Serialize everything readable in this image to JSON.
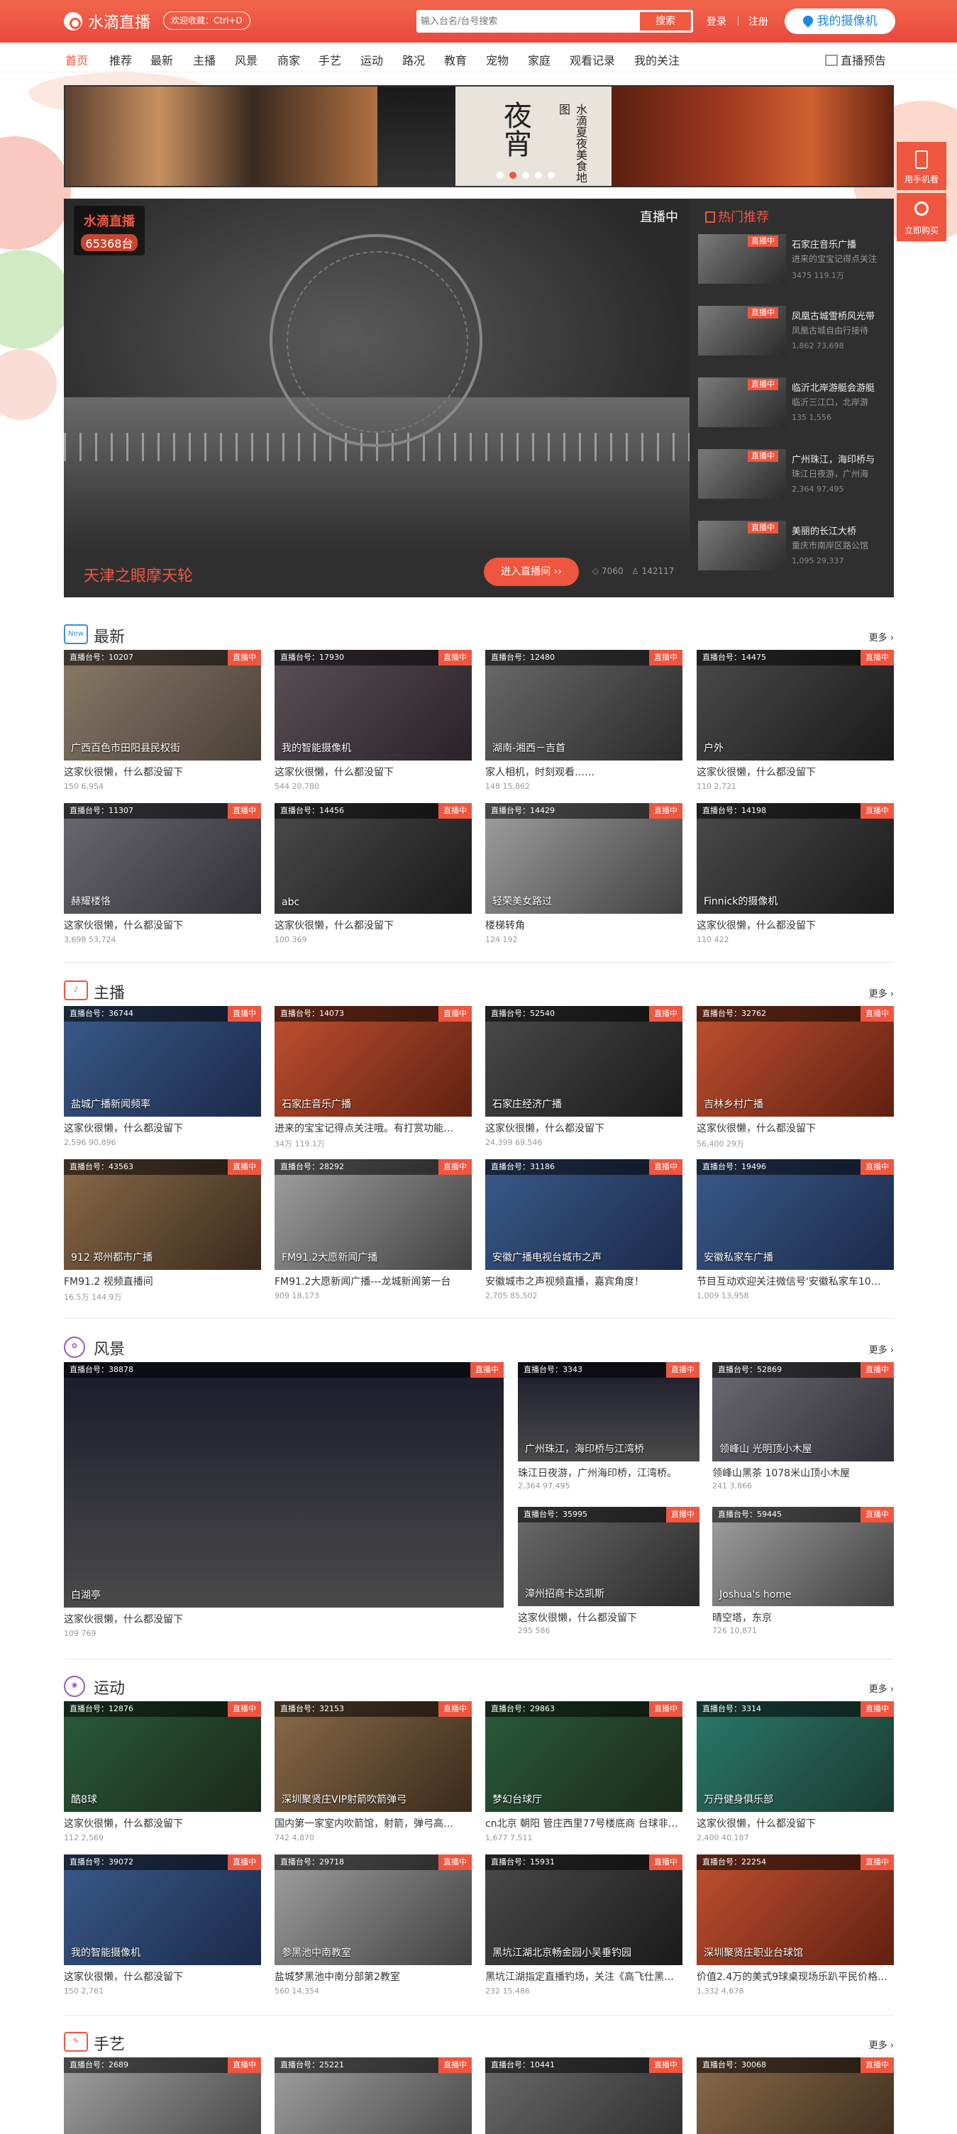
{
  "header": {
    "logo_text": "水滴直播",
    "favorite_label": "欢迎收藏：Ctrl+D",
    "search_placeholder": "输入台名/台号搜索",
    "search_button": "搜索",
    "login": "登录",
    "register": "注册",
    "my_camera": "我的摄像机"
  },
  "nav": {
    "items": [
      "首页",
      "推荐",
      "最新",
      "主播",
      "风景",
      "商家",
      "手艺",
      "运动",
      "路况",
      "教育",
      "宠物",
      "家庭",
      "观看记录",
      "我的关注"
    ],
    "active_index": 0,
    "preview": "直播预告"
  },
  "banner": {
    "title": "夜宵",
    "subtitle": "水滴夏夜美食地图",
    "slides": 5,
    "active_slide": 1
  },
  "side_buttons": [
    "用手机看",
    "立即购买"
  ],
  "featured": {
    "brand": "水滴直播",
    "count": "65368台",
    "live_label": "直播中",
    "name": "天津之眼摩天轮",
    "enter_label": "进入直播间 ››",
    "stat1": "7060",
    "stat2": "142117"
  },
  "hot": {
    "title": "热门推荐",
    "items": [
      {
        "badge": "直播中",
        "title": "石家庄音乐广播",
        "desc": "进来的宝宝记得点关注",
        "stats": "3475  119.1万"
      },
      {
        "badge": "直播中",
        "title": "凤凰古城雪桥风光带",
        "desc": "凤凰古城自由行接待",
        "stats": "1,862  73,698"
      },
      {
        "badge": "直播中",
        "title": "临沂北岸游艇会游艇",
        "desc": "临沂三江口，北岸游",
        "stats": "135  1,556"
      },
      {
        "badge": "直播中",
        "title": "广州珠江，海印桥与",
        "desc": "珠江日夜游，广州海",
        "stats": "2,364  97,495"
      },
      {
        "badge": "直播中",
        "title": "美丽的长江大桥",
        "desc": "重庆市南岸区路公馆",
        "stats": "1,095  29,337"
      }
    ]
  },
  "sections": {
    "latest": {
      "title": "最新",
      "icon": "New",
      "more": "更多 ›",
      "cards": [
        {
          "id": "直播台号：10207",
          "live": "直播中",
          "name": "广西百色市田阳县民权街",
          "desc": "这家伙很懒，什么都没留下",
          "stats": "150  6,954"
        },
        {
          "id": "直播台号：17930",
          "live": "直播中",
          "name": "我的智能摄像机",
          "desc": "这家伙很懒，什么都没留下",
          "stats": "544  20,780"
        },
        {
          "id": "直播台号：12480",
          "live": "直播中",
          "name": "湖南-湘西－吉首",
          "desc": "家人相机，时刻观看……",
          "stats": "148  15,862"
        },
        {
          "id": "直播台号：14475",
          "live": "直播中",
          "name": "户外",
          "desc": "这家伙很懒，什么都没留下",
          "stats": "110  2,721"
        },
        {
          "id": "直播台号：11307",
          "live": "直播中",
          "name": "赫耀楼恪",
          "desc": "这家伙很懒，什么都没留下",
          "stats": "3,698  53,724"
        },
        {
          "id": "直播台号：14456",
          "live": "直播中",
          "name": "abc",
          "desc": "这家伙很懒，什么都没留下",
          "stats": "100  369"
        },
        {
          "id": "直播台号：14429",
          "live": "直播中",
          "name": "轻荣美女路过",
          "desc": "楼梯转角",
          "stats": "124  192"
        },
        {
          "id": "直播台号：14198",
          "live": "直播中",
          "name": "Finnick的摄像机",
          "desc": "这家伙很懒，什么都没留下",
          "stats": "110  422"
        }
      ]
    },
    "anchor": {
      "title": "主播",
      "more": "更多 ›",
      "cards": [
        {
          "id": "直播台号：36744",
          "live": "直播中",
          "name": "盐城广播新闻频率",
          "desc": "这家伙很懒，什么都没留下",
          "stats": "2,596  90,896"
        },
        {
          "id": "直播台号：14073",
          "live": "直播中",
          "name": "石家庄音乐广播",
          "desc": "进来的宝宝记得点关注哦。有打赏功能…",
          "stats": "34万  119.1万"
        },
        {
          "id": "直播台号：52540",
          "live": "直播中",
          "name": "石家庄经济广播",
          "desc": "这家伙很懒，什么都没留下",
          "stats": "24,399  69,546"
        },
        {
          "id": "直播台号：32762",
          "live": "直播中",
          "name": "吉林乡村广播",
          "desc": "这家伙很懒，什么都没留下",
          "stats": "56,400  29万"
        },
        {
          "id": "直播台号：43563",
          "live": "直播中",
          "name": "912 郑州都市广播",
          "desc": "FM91.2 视频直播间",
          "stats": "16.5万  144.9万"
        },
        {
          "id": "直播台号：28292",
          "live": "直播中",
          "name": "FM91.2大愿新闻广播",
          "desc": "FM91.2大愿新闻广播---龙城新闻第一台",
          "stats": "909  18,173"
        },
        {
          "id": "直播台号：31186",
          "live": "直播中",
          "name": "安徽广播电视台城市之声",
          "desc": "安徽城市之声视频直播，嘉宾角度！",
          "stats": "2,705  85,502"
        },
        {
          "id": "直播台号：19496",
          "live": "直播中",
          "name": "安徽私家车广播",
          "desc": "节目互动欢迎关注微信号'安徽私家车10…",
          "stats": "1,009  13,958"
        }
      ]
    },
    "scenery": {
      "title": "风景",
      "more": "更多 ›",
      "big": {
        "id": "直播台号：38878",
        "live": "直播中",
        "name": "白湖亭",
        "desc": "这家伙很懒，什么都没留下",
        "stats": "109  769"
      },
      "cards": [
        {
          "id": "直播台号：3343",
          "live": "直播中",
          "name": "广州珠江，海印桥与江湾桥",
          "desc": "珠江日夜游，广州海印桥，江湾桥。",
          "stats": "2,364  97,495"
        },
        {
          "id": "直播台号：52869",
          "live": "直播中",
          "name": "领峰山 光明顶小木屋",
          "desc": "领峰山黑茶 1078米山顶小木屋",
          "stats": "241  3,866"
        },
        {
          "id": "直播台号：35995",
          "live": "直播中",
          "name": "漳州招商卡达凯斯",
          "desc": "这家伙很懒，什么都没留下",
          "stats": "295  586"
        },
        {
          "id": "直播台号：59445",
          "live": "直播中",
          "name": "Joshua's home",
          "desc": "晴空塔，东京",
          "stats": "726  10,871"
        }
      ]
    },
    "sports": {
      "title": "运动",
      "more": "更多 ›",
      "cards": [
        {
          "id": "直播台号：12876",
          "live": "直播中",
          "name": "酷8球",
          "desc": "这家伙很懒，什么都没留下",
          "stats": "112  2,569"
        },
        {
          "id": "直播台号：32153",
          "live": "直播中",
          "name": "深圳聚贤庄VIP射箭吹箭弹弓",
          "desc": "国内第一家室内吹箭馆，射箭，弹弓高…",
          "stats": "742  4,870"
        },
        {
          "id": "直播台号：29863",
          "live": "直播中",
          "name": "梦幻台球厅",
          "desc": "cn北京 朝阳 管庄西里77号楼底商 台球非…",
          "stats": "1,677  7,511"
        },
        {
          "id": "直播台号：3314",
          "live": "直播中",
          "name": "万丹健身俱乐部",
          "desc": "这家伙很懒，什么都没留下",
          "stats": "2,400  40,187"
        },
        {
          "id": "直播台号：39072",
          "live": "直播中",
          "name": "我的智能摄像机",
          "desc": "这家伙很懒，什么都没留下",
          "stats": "150  2,761"
        },
        {
          "id": "直播台号：29718",
          "live": "直播中",
          "name": "参黑池中南教室",
          "desc": "盐城梦黑池中南分部第2教室",
          "stats": "560  14,354"
        },
        {
          "id": "直播台号：15931",
          "live": "直播中",
          "name": "黑坑江湖北京畅金园小吴垂钓园",
          "desc": "黑坑江湖指定直播钓场，关注《高飞仕黑…",
          "stats": "232  15,486"
        },
        {
          "id": "直播台号：22254",
          "live": "直播中",
          "name": "深圳聚贤庄职业台球馆",
          "desc": "价值2.4万的美式9球桌现场乐趴平民价格…",
          "stats": "1,332  4,678"
        }
      ]
    },
    "craft": {
      "title": "手艺",
      "more": "更多 ›",
      "cards": [
        {
          "id": "直播台号：2689",
          "live": "直播中"
        },
        {
          "id": "直播台号：25221",
          "live": "直播中"
        },
        {
          "id": "直播台号：10441",
          "live": "直播中"
        },
        {
          "id": "直播台号：30068",
          "live": "直播中"
        }
      ]
    }
  }
}
